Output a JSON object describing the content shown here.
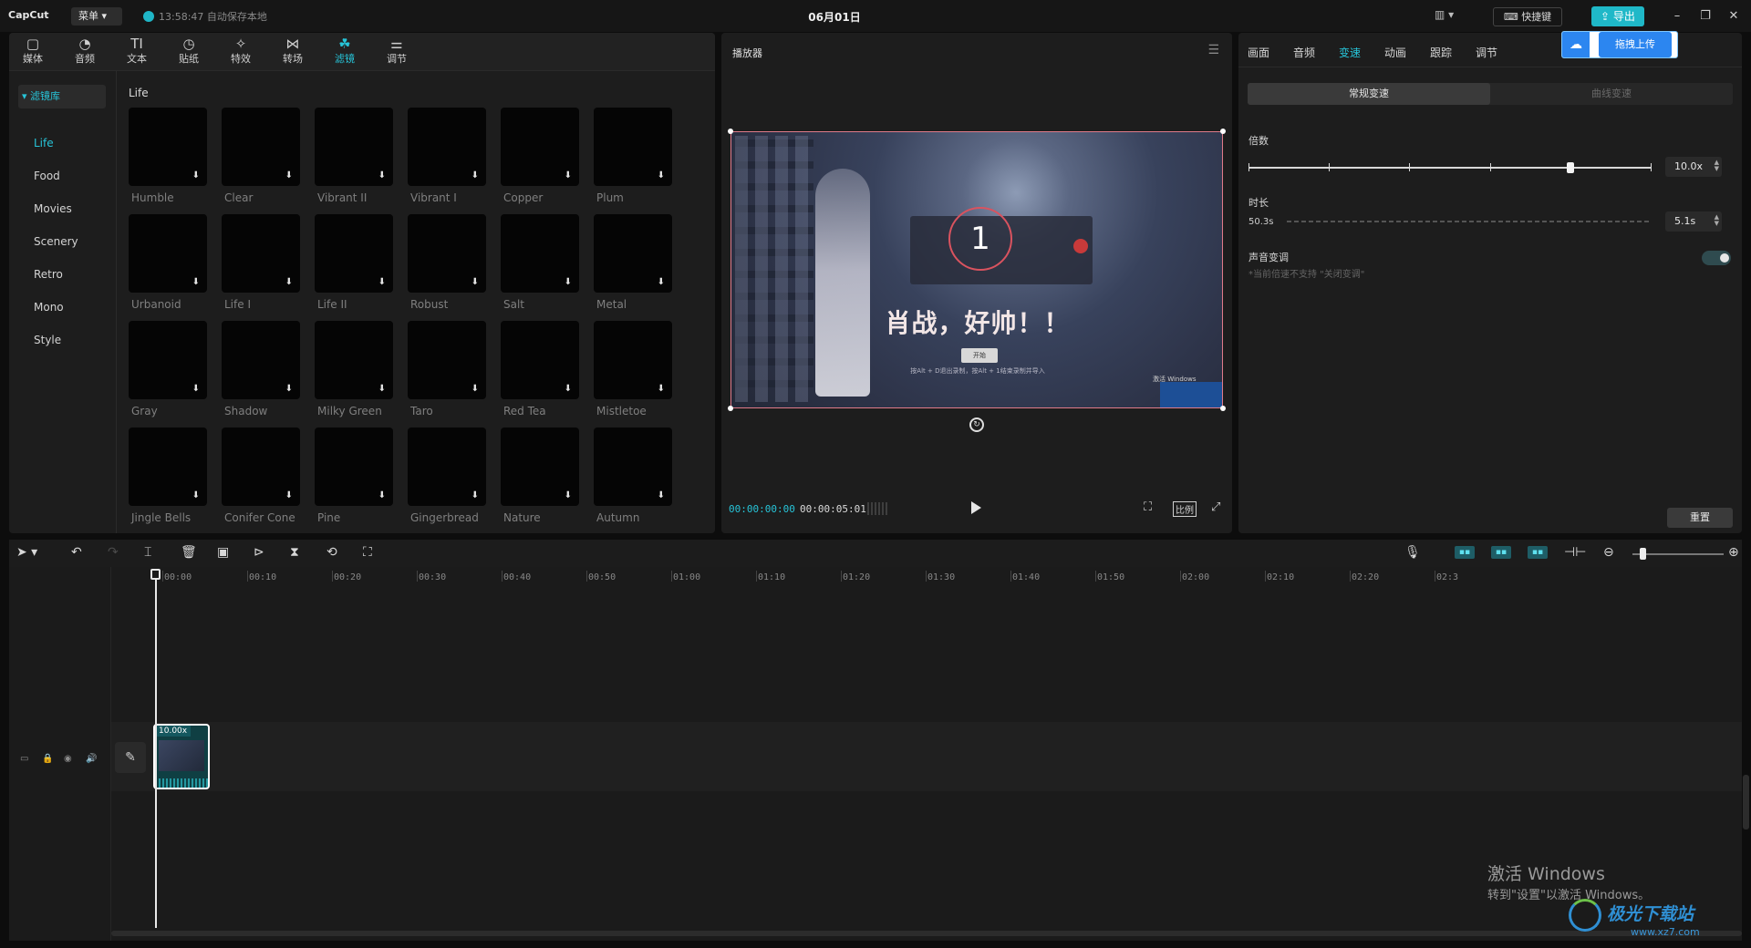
{
  "app": {
    "logo": "CapCut",
    "menu_label": "菜单",
    "save_status": "13:58:47 自动保存本地",
    "title": "06月01日",
    "layout_icon": "layout-icon",
    "shortcut_label": "快捷键",
    "export_label": "导出"
  },
  "media_tabs": [
    {
      "label": "媒体",
      "icon": "▢"
    },
    {
      "label": "音频",
      "icon": "◔"
    },
    {
      "label": "文本",
      "icon": "TI"
    },
    {
      "label": "贴纸",
      "icon": "◷"
    },
    {
      "label": "特效",
      "icon": "✧"
    },
    {
      "label": "转场",
      "icon": "⋈"
    },
    {
      "label": "滤镜",
      "icon": "☘"
    },
    {
      "label": "调节",
      "icon": "⚌"
    }
  ],
  "sidebar": {
    "library_label": "▾ 滤镜库",
    "items": [
      "Life",
      "Food",
      "Movies",
      "Scenery",
      "Retro",
      "Mono",
      "Style"
    ]
  },
  "filters": {
    "section_title": "Life",
    "items": [
      "Humble",
      "Clear",
      "Vibrant II",
      "Vibrant I",
      "Copper",
      "Plum",
      "Urbanoid",
      "Life I",
      "Life II",
      "Robust",
      "Salt",
      "Metal",
      "Gray",
      "Shadow",
      "Milky Green",
      "Taro",
      "Red Tea",
      "Mistletoe",
      "Jingle Bells",
      "Conifer Cone",
      "Pine",
      "Gingerbread",
      "Nature",
      "Autumn"
    ]
  },
  "player": {
    "title": "播放器",
    "countdown": "1",
    "caption": "肖战，好帅！！",
    "start_btn": "开始",
    "hint": "按Alt + D退出录制，按Alt + 1结束录制并导入",
    "activate_small": "激活 Windows",
    "timecode_current": "00:00:00:00",
    "timecode_total": "00:00:05:01",
    "ratio_label": "比例"
  },
  "inspector": {
    "tabs": [
      "画面",
      "音频",
      "变速",
      "动画",
      "跟踪",
      "调节"
    ],
    "active_tab": "变速",
    "upload_label": "拖拽上传",
    "segments": [
      "常规变速",
      "曲线变速"
    ],
    "speed_label": "倍数",
    "speed_value": "10.0x",
    "speed_fraction": 0.8,
    "duration_label": "时长",
    "duration_original": "50.3s",
    "duration_value": "5.1s",
    "pitch_label": "声音变调",
    "pitch_note": "*当前倍速不支持 \"关闭变调\"",
    "reset_label": "重置"
  },
  "timeline": {
    "ruler": [
      "00:00",
      "00:10",
      "00:20",
      "00:30",
      "00:40",
      "00:50",
      "01:00",
      "01:10",
      "01:20",
      "01:30",
      "01:40",
      "01:50",
      "02:00",
      "02:10",
      "02:20",
      "02:3"
    ],
    "clip_speed": "10.00x"
  },
  "desktop": {
    "activate_title": "激活 Windows",
    "activate_sub": "转到\"设置\"以激活 Windows。",
    "watermark": "极光下载站",
    "watermark_url": "www.xz7.com"
  },
  "colors": {
    "accent": "#27c4d8",
    "export": "#1fb8c8",
    "panel": "#1d1d1d",
    "background": "#0d0d0d"
  }
}
